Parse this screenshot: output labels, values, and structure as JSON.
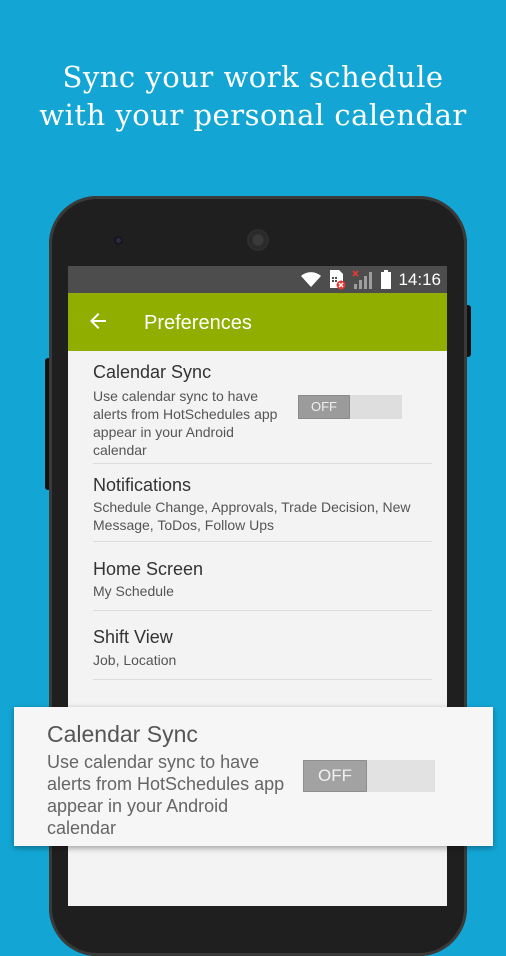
{
  "headline": {
    "line1": "Sync your work schedule",
    "line2": "with your personal calendar"
  },
  "status_bar": {
    "time": "14:16",
    "icons": [
      "wifi-icon",
      "sim-card-error-icon",
      "signal-icon",
      "battery-icon"
    ]
  },
  "app_bar": {
    "back_icon": "arrow-left-icon",
    "title": "Preferences"
  },
  "preferences": {
    "calendar_sync": {
      "title": "Calendar Sync",
      "summary": "Use calendar sync to have alerts from HotSchedules app appear in your Android calendar",
      "toggle_label": "OFF"
    },
    "notifications": {
      "title": "Notifications",
      "summary": "Schedule Change, Approvals, Trade Decision, New Message, ToDos, Follow Ups"
    },
    "home_screen": {
      "title": "Home Screen",
      "summary": "My Schedule"
    },
    "shift_view": {
      "title": "Shift View",
      "summary": "Job, Location"
    }
  },
  "zoom_card": {
    "title": "Calendar Sync",
    "summary": "Use calendar sync to have alerts from HotSchedules app appear in your Android calendar",
    "toggle_label": "OFF"
  },
  "colors": {
    "background": "#13a6d5",
    "app_bar": "#8fae00",
    "status_bar": "#4d4d4d"
  }
}
